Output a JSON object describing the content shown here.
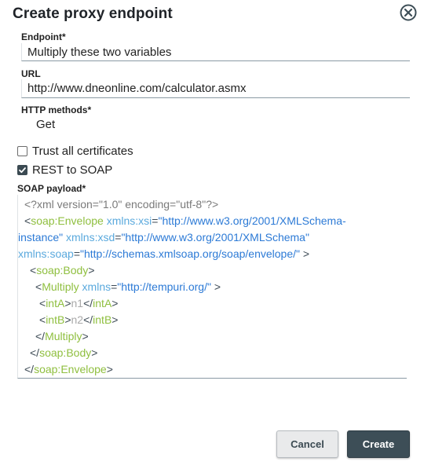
{
  "dialog": {
    "title": "Create proxy endpoint",
    "close_icon": "close-circle-icon"
  },
  "endpoint": {
    "label": "Endpoint*",
    "value": "Multiply these two variables"
  },
  "url": {
    "label": "URL",
    "value": "http://www.dneonline.com/calculator.asmx"
  },
  "http_methods": {
    "label": "HTTP methods*",
    "value": "Get"
  },
  "options": {
    "trust_all": {
      "label": "Trust all certificates",
      "checked": false
    },
    "rest_to_soap": {
      "label": "REST to SOAP",
      "checked": true
    }
  },
  "payload": {
    "label": "SOAP payload*",
    "xml_decl": {
      "open": "<?",
      "text": "xml version=\"1.0\" encoding=\"utf-8\"",
      "close": "?>"
    },
    "envelope_tag": "soap:Envelope",
    "xmlns_xsi_attr": "xmlns:xsi",
    "xmlns_xsi_val_1": "\"http://www.w3.org/2001/XMLSchema-",
    "xmlns_xsi_val_2": "instance\"",
    "xmlns_xsd_attr": "xmlns:xsd",
    "xmlns_xsd_val": "\"http://www.w3.org/2001/XMLSchema\"",
    "xmlns_soap_attr": "xmlns:soap",
    "xmlns_soap_val": "\"http://schemas.xmlsoap.org/soap/envelope/\"",
    "body_tag": "soap:Body",
    "multiply_tag": "Multiply",
    "xmlns_attr": "xmlns",
    "xmlns_val": "\"http://tempuri.org/\"",
    "intA_tag": "intA",
    "intA_val": "n1",
    "intB_tag": "intB",
    "intB_val": "n2"
  },
  "buttons": {
    "cancel": "Cancel",
    "create": "Create"
  },
  "colors": {
    "primary_button": "#3d4e57",
    "xml_tag": "#8fbf3f",
    "xml_attr": "#5aa9dd",
    "xml_string": "#2c7ad6"
  }
}
